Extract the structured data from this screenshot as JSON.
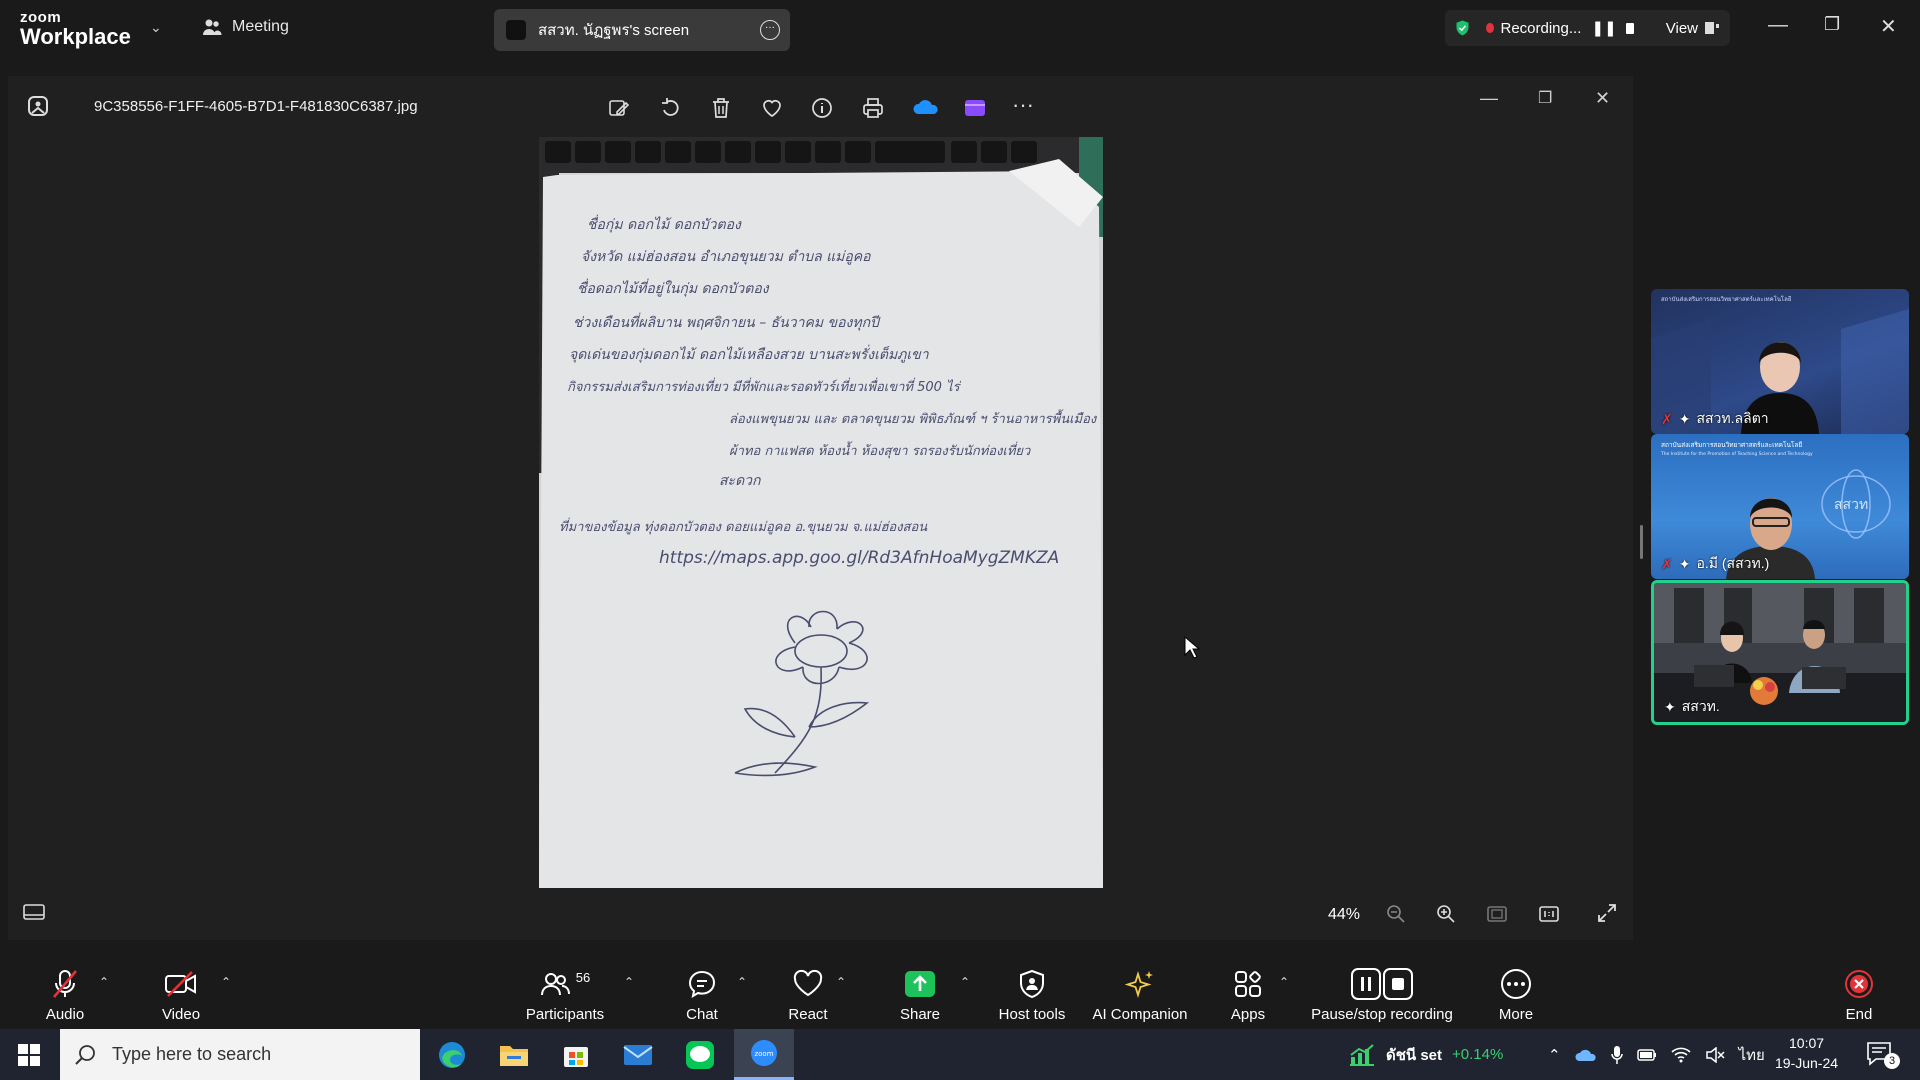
{
  "app": {
    "logo_top": "zoom",
    "logo_bottom": "Workplace",
    "meeting_label": "Meeting",
    "share_pill_label": "สสวท. นัฏฐพร's screen",
    "recording_label": "Recording...",
    "view_label": "View"
  },
  "viewer": {
    "filename": "9C358556-F1FF-4605-B7D1-F481830C6387.jpg",
    "zoom": "44%",
    "note_lines": [
      "ชื่อกุ่ม ดอกไม้ ดอกบัวตอง",
      "จังหวัด แม่ฮ่องสอน  อำเภอขุนยวม  ตำบล แม่อูคอ",
      "ชื่อดอกไม้ที่อยู่ในกุ่ม ดอกบัวตอง",
      "ช่วงเดือนที่ผลิบาน  พฤศจิกายน – ธันวาคม ของทุกปี",
      "จุดเด่นของกุ่มดอกไม้  ดอกไม้เหลืองสวย  บานสะพรั่งเต็มภูเขา",
      "กิจกรรมส่งเสริมการท่องเที่ยว  มีที่พักและรอดทัวร์เที่ยวเพื่อเขาที่ 500 ไร่",
      "ล่องแพขุนยวม และ ตลาดขุนยวม พิพิธภัณฑ์ ฯ ร้านอาหารพื้นเมือง",
      "ผ้าทอ กาแฟสด  ห้องน้ำ  ห้องสุขา  รถรองรับนักท่องเที่ยว",
      "สะดวก",
      "ที่มาของข้อมูล  ทุ่งดอกบัวตอง ดอยแม่อูคอ  อ.ขุนยวม  จ.แม่ฮ่องสอน",
      "https://maps.app.goo.gl/Rd3AfnHoaMygZMKZA"
    ]
  },
  "gallery": [
    {
      "name": "สสวท.ลลิตา",
      "banner": "สถาบันส่งเสริมการสอนวิทยาศาสตร์และเทคโนโลยี"
    },
    {
      "name": "อ.มี (สสวท.)",
      "banner": "สถาบันส่งเสริมการสอนวิทยาศาสตร์และเทคโนโลยี",
      "banner_en": "The Institute for the Promotion of Teaching Science and Technology",
      "logo_text": "สสวท"
    },
    {
      "name": "สสวท."
    }
  ],
  "toolbar": {
    "audio": "Audio",
    "video": "Video",
    "participants": "Participants",
    "participants_count": "56",
    "chat": "Chat",
    "react": "React",
    "share": "Share",
    "host_tools": "Host tools",
    "ai_companion": "AI Companion",
    "apps": "Apps",
    "pause_recording": "Pause/stop recording",
    "more": "More",
    "end": "End"
  },
  "taskbar": {
    "search_placeholder": "Type here to search",
    "stock_label": "ดัชนี set",
    "stock_change": "+0.14%",
    "language": "ไทย",
    "time": "10:07",
    "date": "19-Jun-24",
    "notifications": "3"
  },
  "colors": {
    "accent_green": "#19c26b",
    "recording_red": "#e0343a",
    "share_green": "#1ec25a",
    "end_red": "#e0343a",
    "active_speaker": "#23d18b"
  }
}
